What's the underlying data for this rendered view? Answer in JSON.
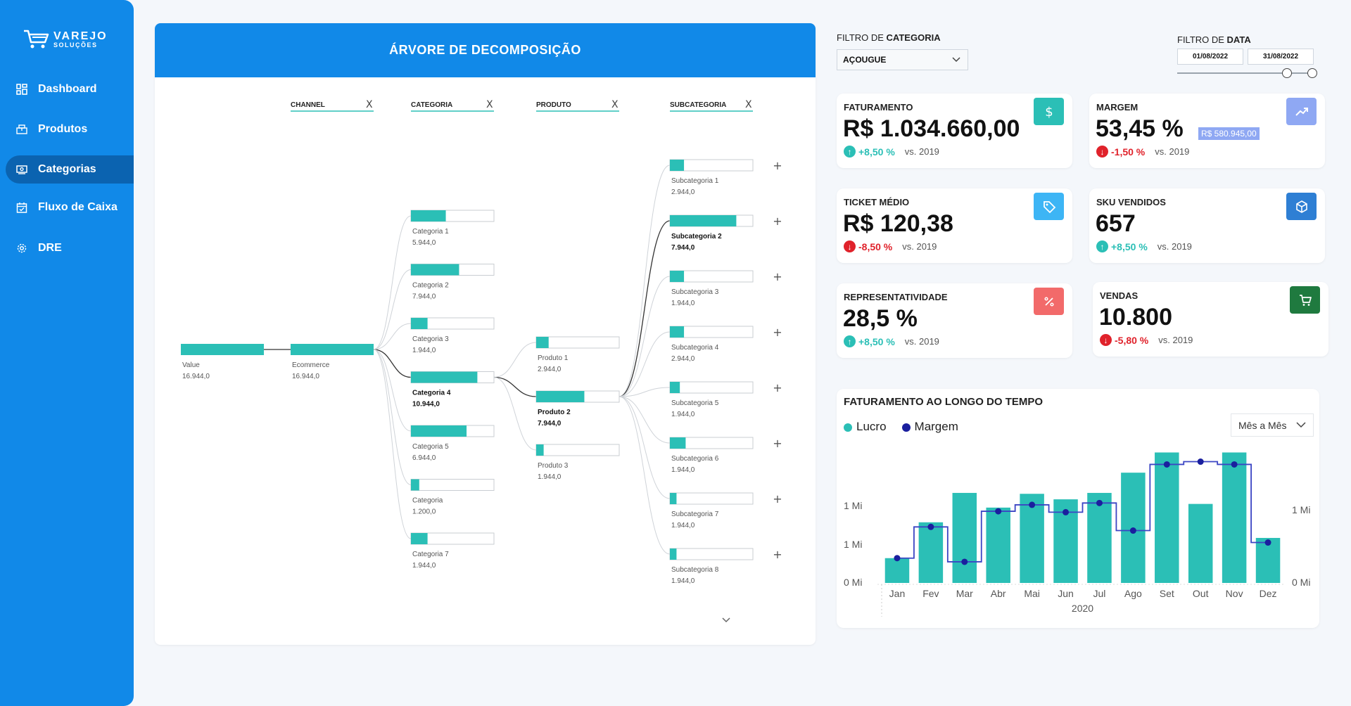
{
  "brand": {
    "line1": "VAREJO",
    "line2": "SOLUÇÕES"
  },
  "nav": [
    {
      "label": "Dashboard",
      "icon": "grid-icon",
      "active": false
    },
    {
      "label": "Produtos",
      "icon": "box-icon",
      "active": false
    },
    {
      "label": "Categorias",
      "icon": "money-icon",
      "active": true
    },
    {
      "label": "Fluxo de Caixa",
      "icon": "calendar-icon",
      "active": false
    },
    {
      "label": "DRE",
      "icon": "gear-icon",
      "active": false
    }
  ],
  "tree": {
    "title": "ÁRVORE DE DECOMPOSIÇÃO",
    "headers": [
      "CHANNEL",
      "CATEGORIA",
      "PRODUTO",
      "SUBCATEGORIA"
    ],
    "close_glyph": "X",
    "expand_glyph": "+",
    "root": {
      "label": "Value",
      "value": "16.944,0",
      "fill": 1.0
    },
    "channel": {
      "label": "Ecommerce",
      "value": "16.944,0",
      "fill": 1.0
    },
    "categorias": [
      {
        "label": "Categoria 1",
        "value": "5.944,0",
        "fill": 0.42,
        "selected": false
      },
      {
        "label": "Categoria 2",
        "value": "7.944,0",
        "fill": 0.58,
        "selected": false
      },
      {
        "label": "Categoria 3",
        "value": "1.944,0",
        "fill": 0.2,
        "selected": false
      },
      {
        "label": "Categoria 4",
        "value": "10.944,0",
        "fill": 0.8,
        "selected": true
      },
      {
        "label": "Categoria 5",
        "value": "6.944,0",
        "fill": 0.67,
        "selected": false
      },
      {
        "label": "Categoria",
        "value": "1.200,0",
        "fill": 0.1,
        "selected": false
      },
      {
        "label": "Categoria 7",
        "value": "1.944,0",
        "fill": 0.2,
        "selected": false
      }
    ],
    "produtos": [
      {
        "label": "Produto 1",
        "value": "2.944,0",
        "fill": 0.15,
        "selected": false
      },
      {
        "label": "Produto 2",
        "value": "7.944,0",
        "fill": 0.58,
        "selected": true
      },
      {
        "label": "Produto 3",
        "value": "1.944,0",
        "fill": 0.09,
        "selected": false
      }
    ],
    "subcategorias": [
      {
        "label": "Subcategoria 1",
        "value": "2.944,0",
        "fill": 0.17,
        "selected": false
      },
      {
        "label": "Subcategoria 2",
        "value": "7.944,0",
        "fill": 0.8,
        "selected": true
      },
      {
        "label": "Subcategoria 3",
        "value": "1.944,0",
        "fill": 0.17,
        "selected": false
      },
      {
        "label": "Subcategoria 4",
        "value": "2.944,0",
        "fill": 0.17,
        "selected": false
      },
      {
        "label": "Subcategoria 5",
        "value": "1.944,0",
        "fill": 0.12,
        "selected": false
      },
      {
        "label": "Subcategoria 6",
        "value": "1.944,0",
        "fill": 0.19,
        "selected": false
      },
      {
        "label": "Subcategoria 7",
        "value": "1.944,0",
        "fill": 0.08,
        "selected": false
      },
      {
        "label": "Subcategoria 8",
        "value": "1.944,0",
        "fill": 0.08,
        "selected": false
      }
    ]
  },
  "filters": {
    "categoria_label_prefix": "FILTRO DE ",
    "categoria_label_bold": "CATEGORIA",
    "categoria_value": "AÇOUGUE",
    "data_label_prefix": "FILTRO DE ",
    "data_label_bold": "DATA",
    "date_start": "01/08/2022",
    "date_end": "31/08/2022"
  },
  "kpis": {
    "faturamento": {
      "title": "FATURAMENTO",
      "value": "R$ 1.034.660,00",
      "delta": "+8,50 %",
      "direction": "up",
      "vs": "vs. 2019",
      "icon": "dollar-icon"
    },
    "margem": {
      "title": "MARGEM",
      "value": "53,45 %",
      "badge": "R$ 580.945,00",
      "delta": "-1,50 %",
      "direction": "down",
      "vs": "vs. 2019",
      "icon": "trend-up-icon"
    },
    "ticket": {
      "title": "TICKET MÉDIO",
      "value": "R$ 120,38",
      "delta": "-8,50 %",
      "direction": "down",
      "vs": "vs. 2019",
      "icon": "tag-icon"
    },
    "sku": {
      "title": "SKU VENDIDOS",
      "value": "657",
      "delta": "+8,50 %",
      "direction": "up",
      "vs": "vs. 2019",
      "icon": "cube-icon"
    },
    "representatividade": {
      "title": "REPRESENTATIVIDADE",
      "value": "28,5 %",
      "delta": "+8,50 %",
      "direction": "up",
      "vs": "vs. 2019",
      "icon": "percent-icon"
    },
    "vendas": {
      "title": "VENDAS",
      "value": "10.800",
      "delta": "-5,80 %",
      "direction": "down",
      "vs": "vs. 2019",
      "icon": "cart-icon"
    }
  },
  "colors": {
    "teal": "#2bbfb6",
    "blue": "#1189e8",
    "navy": "#1a1f9e",
    "up": "#2bbfb6",
    "down": "#e0222b"
  },
  "chart": {
    "title": "FATURAMENTO AO LONGO DO TEMPO",
    "dropdown": "Mês a Mês",
    "legend": [
      "Lucro",
      "Margem"
    ]
  },
  "chart_data": {
    "type": "bar",
    "title": "FATURAMENTO AO LONGO DO TEMPO",
    "categories": [
      "Jan",
      "Fev",
      "Mar",
      "Abr",
      "Mai",
      "Jun",
      "Jul",
      "Ago",
      "Set",
      "Out",
      "Nov",
      "Dez"
    ],
    "x_group_label": "2020",
    "series": [
      {
        "name": "Lucro",
        "type": "bar",
        "values": [
          0.27,
          0.66,
          0.98,
          0.82,
          0.97,
          0.91,
          0.98,
          1.2,
          1.42,
          0.86,
          1.42,
          0.49
        ]
      },
      {
        "name": "Margem",
        "type": "step-line",
        "values": [
          0.27,
          0.61,
          0.23,
          0.78,
          0.85,
          0.77,
          0.87,
          0.57,
          1.29,
          1.32,
          1.29,
          0.44
        ]
      }
    ],
    "y_ticks_left": [
      "0 Mi",
      "1 Mi",
      "1 Mi"
    ],
    "y_ticks_right": [
      "0 Mi",
      "1 Mi"
    ],
    "ylim": [
      0,
      1.5
    ],
    "legend_position": "top-left"
  }
}
